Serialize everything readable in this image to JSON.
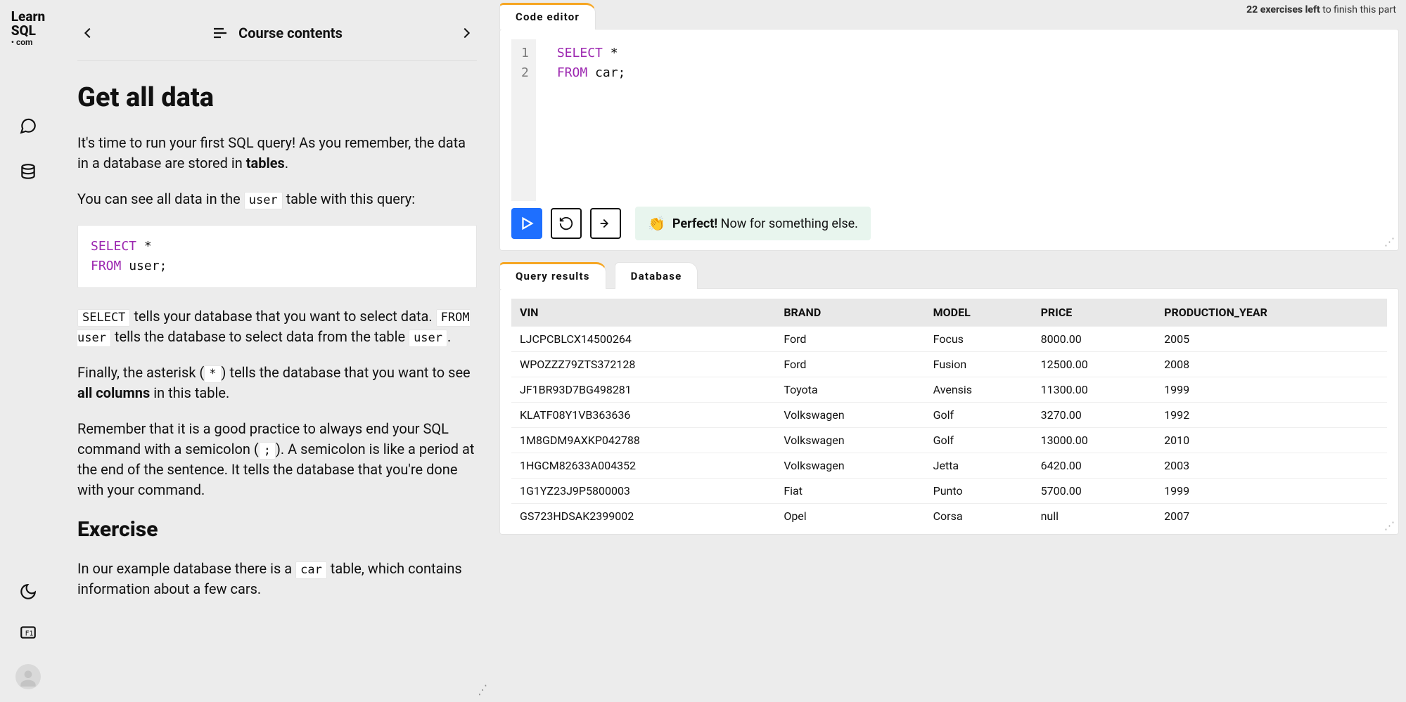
{
  "logo": {
    "line1": "Learn",
    "line2": "SQL",
    "line3": "• com"
  },
  "rail_icons": {
    "chat": "chat-icon",
    "db": "database-icon",
    "theme": "moon-icon",
    "key": "keyboard-shortcut-icon",
    "avatar": "avatar-icon"
  },
  "lesson_nav": {
    "prev": "←",
    "next": "→",
    "contents_label": "Course contents"
  },
  "header_status": {
    "count": "22",
    "rest": " exercises left",
    "tail": " to finish this part"
  },
  "lesson": {
    "title": "Get all data",
    "p1_a": "It's time to run your first SQL query! As you remember, the data in a database are stored in ",
    "p1_b_strong": "tables",
    "p1_c": ".",
    "p2_a": "You can see all data in the ",
    "p2_code": "user",
    "p2_b": " table with this query:",
    "codeblock": {
      "kw1": "SELECT",
      "rest1": " *",
      "kw2": "FROM",
      "rest2": " user",
      "tail": ";"
    },
    "p3_code_a": "SELECT",
    "p3_a": " tells your database that you want to select data. ",
    "p3_code_b": "FROM user",
    "p3_b": " tells the database to select data from the table ",
    "p3_code_c": "user",
    "p3_c": ".",
    "p4_a": "Finally, the asterisk (",
    "p4_code": "*",
    "p4_b": ") tells the database that you want to see ",
    "p4_strong": "all columns",
    "p4_c": " in this table.",
    "p5_a": "Remember that it is a good practice to always end your SQL command with a semicolon (",
    "p5_code": ";",
    "p5_b": "). A semicolon is like a period at the end of the sentence. It tells the database that you're done with your command.",
    "exercise_heading": "Exercise",
    "p6_a": "In our example database there is a ",
    "p6_code": "car",
    "p6_b": " table, which contains information about a few cars."
  },
  "editor": {
    "tab_label": "Code editor",
    "lines": [
      {
        "kw": "SELECT",
        "rest": " *"
      },
      {
        "kw": "FROM",
        "rest": " car;"
      }
    ],
    "feedback_emoji": "👏",
    "feedback_bold": "Perfect!",
    "feedback_rest": " Now for something else."
  },
  "results": {
    "tabs": {
      "primary": "Query results",
      "secondary": "Database"
    },
    "columns": [
      "VIN",
      "BRAND",
      "MODEL",
      "PRICE",
      "PRODUCTION_YEAR"
    ],
    "rows": [
      [
        "LJCPCBLCX14500264",
        "Ford",
        "Focus",
        "8000.00",
        "2005"
      ],
      [
        "WPOZZZ79ZTS372128",
        "Ford",
        "Fusion",
        "12500.00",
        "2008"
      ],
      [
        "JF1BR93D7BG498281",
        "Toyota",
        "Avensis",
        "11300.00",
        "1999"
      ],
      [
        "KLATF08Y1VB363636",
        "Volkswagen",
        "Golf",
        "3270.00",
        "1992"
      ],
      [
        "1M8GDM9AXKP042788",
        "Volkswagen",
        "Golf",
        "13000.00",
        "2010"
      ],
      [
        "1HGCM82633A004352",
        "Volkswagen",
        "Jetta",
        "6420.00",
        "2003"
      ],
      [
        "1G1YZ23J9P5800003",
        "Fiat",
        "Punto",
        "5700.00",
        "1999"
      ],
      [
        "GS723HDSAK2399002",
        "Opel",
        "Corsa",
        "null",
        "2007"
      ]
    ]
  }
}
